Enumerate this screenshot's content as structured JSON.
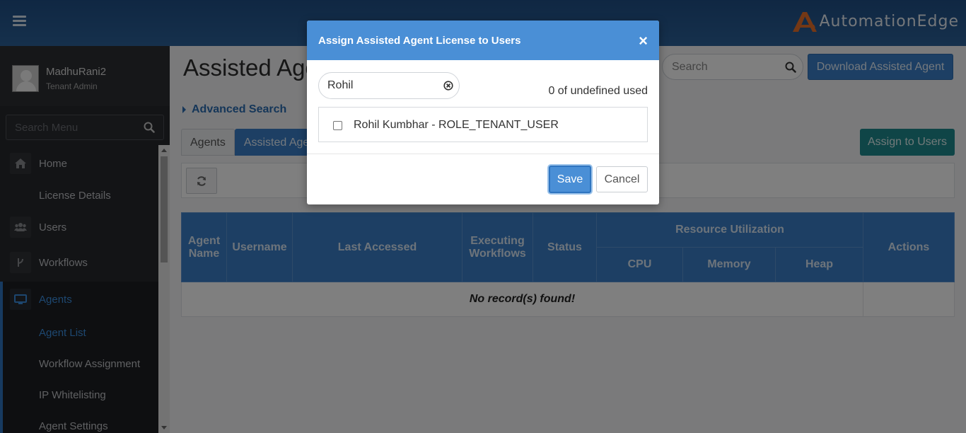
{
  "app": {
    "brand": "AutomationEdge",
    "brand_color": "#e8712a"
  },
  "profile": {
    "name": "MadhuRani2",
    "role": "Tenant Admin"
  },
  "sidebar": {
    "search_placeholder": "Search Menu",
    "items": [
      {
        "label": "Home",
        "icon": "home-icon"
      },
      {
        "label": "License Details"
      },
      {
        "label": "Users",
        "icon": "users-icon"
      },
      {
        "label": "Workflows",
        "icon": "workflow-icon"
      },
      {
        "label": "Agents",
        "icon": "monitor-icon"
      },
      {
        "label": "Agent List"
      },
      {
        "label": "Workflow Assignment"
      },
      {
        "label": "IP Whitelisting"
      },
      {
        "label": "Agent Settings"
      }
    ]
  },
  "main": {
    "title": "Assisted Agents",
    "search_placeholder": "Search",
    "download_button": "Download Assisted Agent",
    "advanced_search": "Advanced Search",
    "tabs": [
      {
        "label": "Agents"
      },
      {
        "label": "Assisted Agents"
      }
    ],
    "assign_button": "Assign to Users",
    "table": {
      "headers": {
        "agent_name": "Agent Name",
        "username": "Username",
        "last_accessed": "Last Accessed",
        "executing_workflows": "Executing Workflows",
        "status": "Status",
        "resource_utilization": "Resource Utilization",
        "cpu": "CPU",
        "memory": "Memory",
        "heap": "Heap",
        "actions": "Actions"
      },
      "empty_message": "No record(s) found!"
    }
  },
  "modal": {
    "title": "Assign Assisted Agent License to Users",
    "close": "×",
    "filter_value": "Rohil",
    "used_text": "0 of undefined used",
    "users": [
      {
        "label": "Rohil Kumbhar - ROLE_TENANT_USER",
        "checked": false
      }
    ],
    "save": "Save",
    "cancel": "Cancel"
  }
}
